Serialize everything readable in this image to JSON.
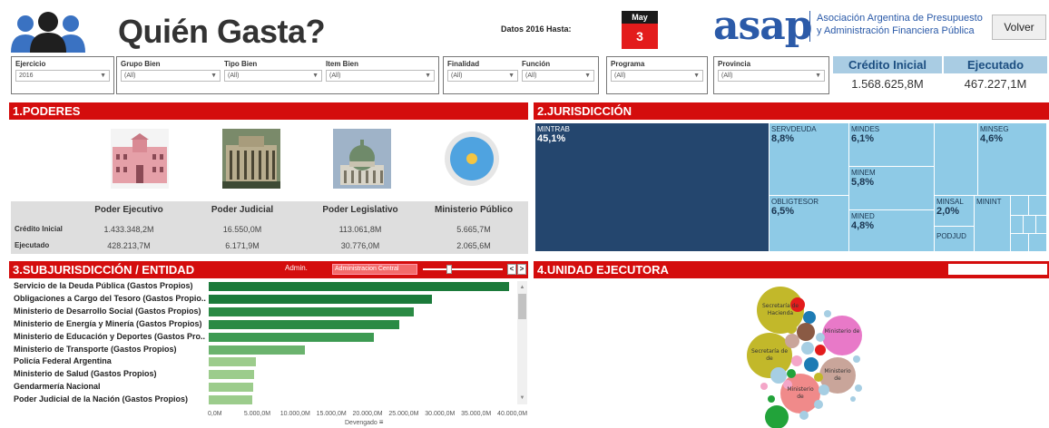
{
  "header": {
    "title": "Quién Gasta?",
    "datos_label": "Datos 2016 Hasta:",
    "calendar_month": "May",
    "calendar_day": "3",
    "logo_text": "asap",
    "logo_org_line1": "Asociación Argentina de Presupuesto",
    "logo_org_line2": "y Administración Financiera Pública",
    "volver_label": "Volver",
    "brand_color": "#2b5aa8",
    "accent_red": "#d40d0d"
  },
  "filters": {
    "ejercicio": {
      "label": "Ejercicio",
      "value": "2016"
    },
    "grupo_bien": {
      "label": "Grupo Bien",
      "value": "(All)"
    },
    "tipo_bien": {
      "label": "Tipo Bien",
      "value": "(All)"
    },
    "item_bien": {
      "label": "Item Bien",
      "value": "(All)"
    },
    "finalidad": {
      "label": "Finalidad",
      "value": "(All)"
    },
    "funcion": {
      "label": "Función",
      "value": "(All)"
    },
    "programa": {
      "label": "Programa",
      "value": "(All)"
    },
    "provincia": {
      "label": "Provincia",
      "value": "(All)"
    }
  },
  "kpis": {
    "credito_label": "Crédito Inicial",
    "credito_value": "1.568.625,8M",
    "ejecutado_label": "Ejecutado",
    "ejecutado_value": "467.227,1M"
  },
  "poderes": {
    "section_title": "1.PODERES",
    "icons": [
      "casa-rosada-icon",
      "palacio-justicia-icon",
      "congreso-icon",
      "ministerio-publico-icon"
    ],
    "columns": [
      "Poder Ejecutivo",
      "Poder Judicial",
      "Poder Legislativo",
      "Ministerio Público"
    ],
    "row_credito_label": "Crédito Inicial",
    "row_ejecutado_label": "Ejecutado",
    "credito": [
      "1.433.348,2M",
      "16.550,0M",
      "113.061,8M",
      "5.665,7M"
    ],
    "ejecutado": [
      "428.213,7M",
      "6.171,9M",
      "30.776,0M",
      "2.065,6M"
    ]
  },
  "jurisdiccion": {
    "section_title": "2.JURISDICCIÓN",
    "tiles": [
      {
        "name": "MINTRAB",
        "pct": "45,1%"
      },
      {
        "name": "SERVDEUDA",
        "pct": "8,8%"
      },
      {
        "name": "MINDES",
        "pct": "6,1%"
      },
      {
        "name": "MINSEG",
        "pct": "4,6%"
      },
      {
        "name": "MINEM",
        "pct": "5,8%"
      },
      {
        "name": "OBLIGTESOR",
        "pct": "6,5%"
      },
      {
        "name": "MINED",
        "pct": "4,8%"
      },
      {
        "name": "MINSAL",
        "pct": "2,0%"
      },
      {
        "name": "MININT",
        "pct": ""
      },
      {
        "name": "PODJUD",
        "pct": ""
      }
    ]
  },
  "subjurisdiccion": {
    "section_title": "3.SUBJURISDICCIÓN / ENTIDAD",
    "admin_label": "Admin.",
    "admin_value": "Administracion Central",
    "prev_label": "<",
    "next_label": ">",
    "axis_title": "Devengado"
  },
  "chart_data": {
    "type": "bar",
    "orientation": "horizontal",
    "categories": [
      "Servicio de la Deuda Pública (Gastos Propios)",
      "Obligaciones a Cargo del Tesoro (Gastos Propio..",
      "Ministerio de Desarrollo Social (Gastos Propios)",
      "Ministerio de Energía y Minería (Gastos Propios)",
      "Ministerio de Educación y Deportes (Gastos Pro..",
      "Ministerio de Transporte (Gastos Propios)",
      "Policía Federal Argentina",
      "Ministerio de Salud (Gastos Propios)",
      "Gendarmería Nacional",
      "Poder Judicial de la Nación (Gastos Propios)"
    ],
    "values": [
      41500,
      30800,
      28300,
      26300,
      22800,
      13300,
      6500,
      6300,
      6200,
      6000
    ],
    "colors": [
      "#1b7a3a",
      "#1b7a3a",
      "#2a8a44",
      "#2a8a44",
      "#3d9a52",
      "#6bb36e",
      "#9ccc8c",
      "#9ccc8c",
      "#9ccc8c",
      "#9ccc8c"
    ],
    "xlim": [
      0,
      42000
    ],
    "x_ticks": [
      "0,0M",
      "5.000,0M",
      "10.000,0M",
      "15.000,0M",
      "20.000,0M",
      "25.000,0M",
      "30.000,0M",
      "35.000,0M",
      "40.000,0M"
    ],
    "xlabel": "Devengado",
    "grid": false
  },
  "unidad": {
    "section_title": "4.UNIDAD EJECUTORA",
    "bubbles": [
      {
        "label": "Secretaría de Hacienda",
        "color": "#c2b82a"
      },
      {
        "label": "Secretaría de",
        "color": "#c2b82a"
      },
      {
        "label": "Ministerio de",
        "color": "#e879c8"
      },
      {
        "label": "Ministerio de",
        "color": "#c9a59a"
      },
      {
        "label": "Ministerio de",
        "color": "#f08a8a"
      }
    ]
  }
}
